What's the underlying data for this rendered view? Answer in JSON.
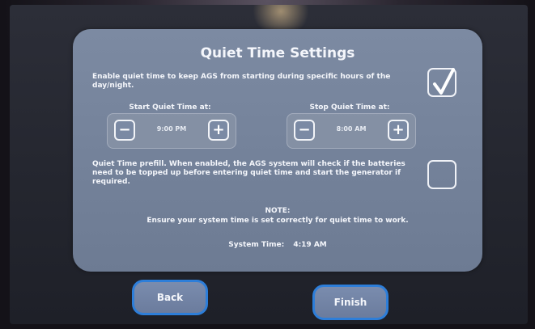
{
  "dialog": {
    "title": "Quiet Time Settings",
    "enable_text": "Enable quiet time to keep AGS from starting during specific hours of the day/night.",
    "enable_checked": true,
    "start_label": "Start Quiet Time at:",
    "start_value": "9:00 PM",
    "stop_label": "Stop Quiet Time at:",
    "stop_value": "8:00 AM",
    "minus_glyph": "−",
    "plus_glyph": "+",
    "prefill_text": "Quiet Time prefill. When enabled, the AGS system will check if the batteries need to be topped up before entering quiet time and start the generator if required.",
    "prefill_checked": false,
    "note_heading": "NOTE:",
    "note_text": "Ensure your system time is set correctly for quiet time to work.",
    "system_time_label": "System Time:",
    "system_time_value": "4:19 AM"
  },
  "buttons": {
    "back": "Back",
    "finish": "Finish"
  },
  "colors": {
    "panel": "#7384a0",
    "button_border": "#2d7ed9",
    "text": "#f4f6fb"
  }
}
